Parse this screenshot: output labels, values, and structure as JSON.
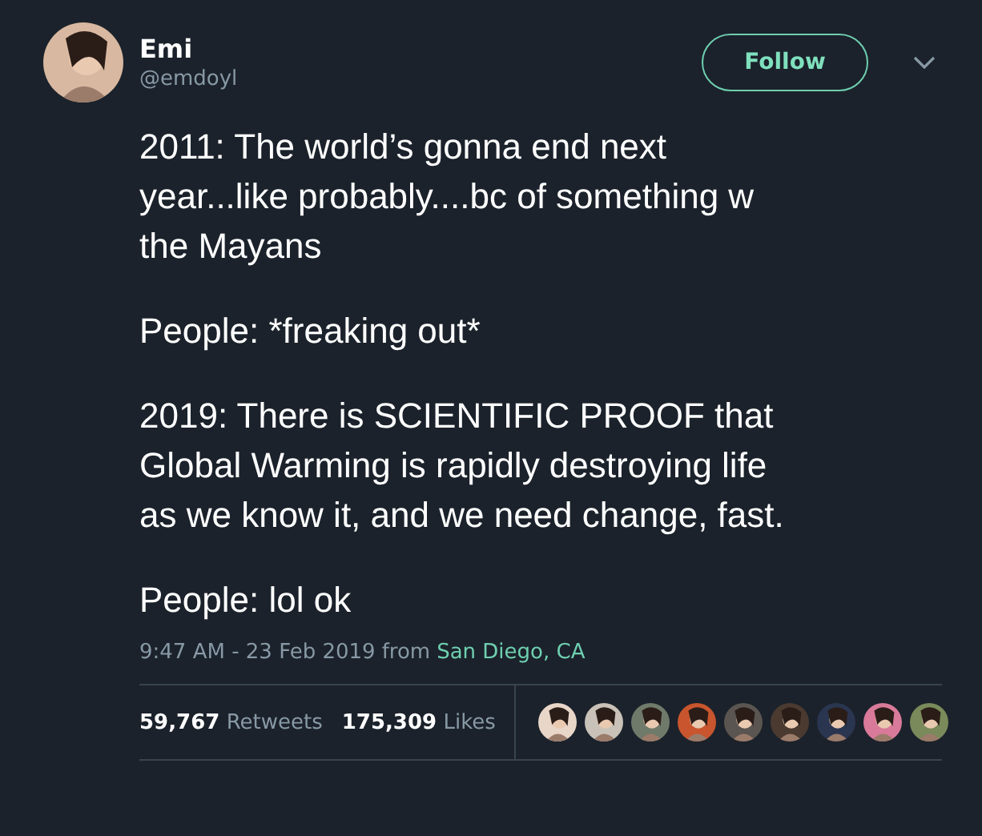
{
  "author": {
    "name": "Emi",
    "handle": "@emdoyl"
  },
  "follow_button": {
    "label": "Follow"
  },
  "paragraphs": [
    "2011: The world’s gonna end next\nyear...like probably....bc of something w\nthe Mayans",
    "People: *freaking out*",
    "2019: There is SCIENTIFIC PROOF that\nGlobal Warming is rapidly destroying life\nas we know it, and we need change, fast.",
    "People: lol ok"
  ],
  "timestamp": "9:47 AM - 23 Feb 2019",
  "from": "from",
  "location": "San Diego, CA",
  "stats": [
    {
      "count": "59,767",
      "label": "Retweets"
    },
    {
      "count": "175,309",
      "label": "Likes"
    }
  ]
}
